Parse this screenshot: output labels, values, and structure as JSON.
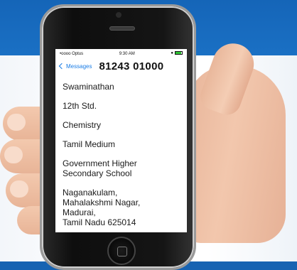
{
  "status_bar": {
    "carrier": "•oooo Optus",
    "time": "9:30 AM"
  },
  "nav": {
    "back_label": "Messages",
    "contact": "81243 01000"
  },
  "messages": [
    "Swaminathan",
    "12th Std.",
    "Chemistry",
    "Tamil Medium",
    "Government Higher\nSecondary School",
    "Naganakulam,\nMahalakshmi Nagar,\nMadurai,\nTamil Nadu 625014"
  ],
  "colors": {
    "background_blue": "#1565b8",
    "link_blue": "#1a7de6",
    "battery_green": "#2ec533"
  }
}
